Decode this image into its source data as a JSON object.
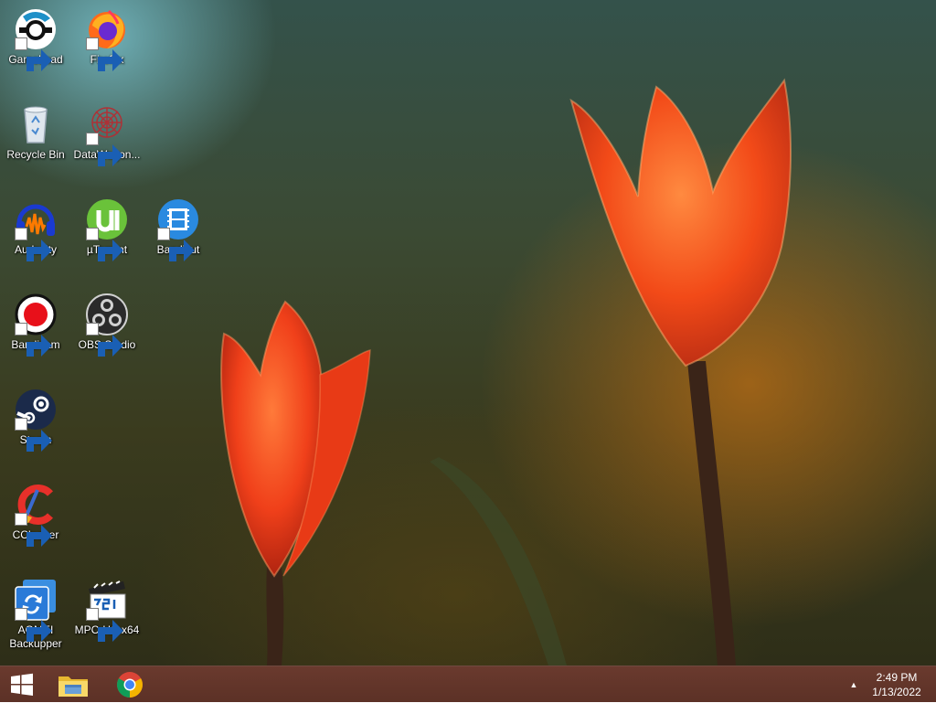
{
  "desktop": {
    "icons": [
      {
        "label": "GameLoad"
      },
      {
        "label": "Firefox"
      },
      {
        "label": "Recycle Bin"
      },
      {
        "label": "DataWagon..."
      },
      {
        "label": "Audacity"
      },
      {
        "label": "µTorrent"
      },
      {
        "label": "Bandicut"
      },
      {
        "label": "Bandicam"
      },
      {
        "label": "OBS Studio"
      },
      {
        "label": "Steam"
      },
      {
        "label": "CCleaner"
      },
      {
        "label": "AOMEI Backupper"
      },
      {
        "label": "MPC-HC x64"
      }
    ]
  },
  "taskbar": {
    "tray_arrow": "▲",
    "clock": {
      "time": "2:49 PM",
      "date": "1/13/2022"
    }
  },
  "colors": {
    "taskbar": "#5c3126",
    "tulip_petal": "#ff4a1a",
    "tulip_glow": "#ffb060"
  }
}
